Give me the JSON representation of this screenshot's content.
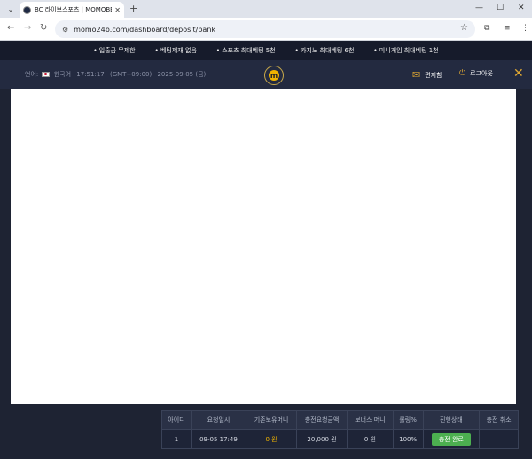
{
  "browser": {
    "tab_title": "BC 라이브스포츠 | MOMOBET",
    "url": "momo24b.com/dashboard/deposit/bank"
  },
  "promo": {
    "items": [
      "• 입출금 무제한",
      "• 베팅제재 없음",
      "• 스포츠 최대베팅 5천",
      "• 카지노 최대베팅 6천",
      "• 미니게임 최대베팅 1천"
    ]
  },
  "header": {
    "lang_prefix": "언어:",
    "lang": "한국어",
    "time": "17:51:17",
    "timezone": "(GMT+09:00)",
    "date": "2025-09-05 (금)",
    "logo": "m",
    "mailbox_label": "편지함",
    "logout_label": "로그아웃"
  },
  "table": {
    "headers": [
      "아이디",
      "요청일시",
      "기존보유머니",
      "충전요청금액",
      "보너스 머니",
      "롤링%",
      "진행상태",
      "충전 취소"
    ],
    "rows": [
      {
        "id": "1",
        "datetime": "09-05 17:49",
        "prev_money": "0 원",
        "request_amount": "20,000 원",
        "bonus": "0 원",
        "rolling": "100%",
        "status": "충전 완료",
        "cancel": ""
      }
    ]
  },
  "colors": {
    "accent": "#f0b400",
    "status_complete": "#4caf50",
    "background": "#1e2333"
  }
}
